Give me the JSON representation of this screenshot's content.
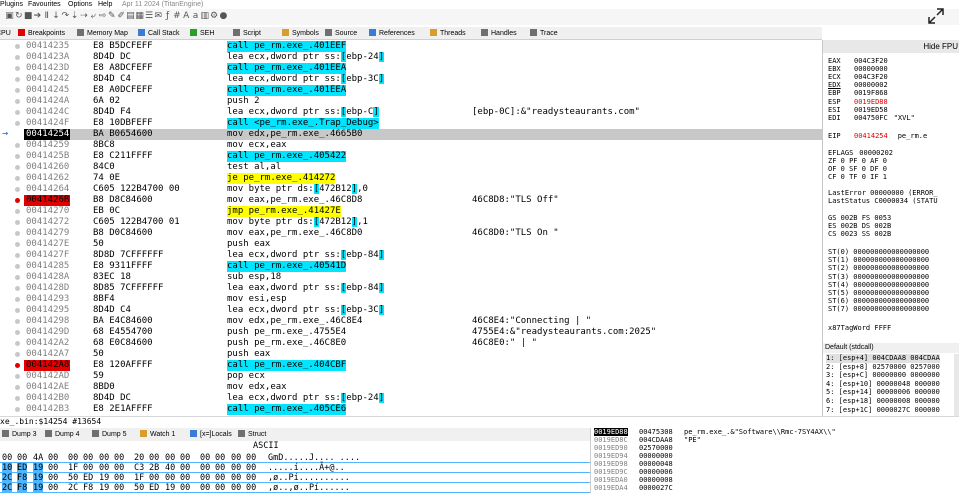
{
  "menu": {
    "items": [
      "Plugins",
      "Favourites",
      "Options",
      "Help"
    ],
    "version": "Apr 11 2024 (TitanEngine)"
  },
  "toolbar_icons": [
    "open-icon",
    "restart-icon",
    "close-icon",
    "run-icon",
    "pause-icon",
    "step-into-icon",
    "step-over-icon",
    "trace-into-icon",
    "trace-over-icon",
    "execute-till-return-icon",
    "run-to-user-code-icon",
    "highlight-icon",
    "pen-icon",
    "paint-icon",
    "calc-icon",
    "list-icon",
    "script-icon",
    "fx-icon",
    "hash-icon",
    "font-icon",
    "abc-icon",
    "patch-icon",
    "settings-icon",
    "help-icon"
  ],
  "tabs": [
    {
      "label": "CPU",
      "icon": "cpu-icon",
      "color": "#3a7bd5"
    },
    {
      "label": "Breakpoints",
      "icon": "breakpoint-icon",
      "color": "#e00000"
    },
    {
      "label": "Memory Map",
      "icon": "memory-map-icon",
      "color": "#707070"
    },
    {
      "label": "Call Stack",
      "icon": "call-stack-icon",
      "color": "#3a7bd5"
    },
    {
      "label": "SEH",
      "icon": "seh-icon",
      "color": "#2a9d2a"
    },
    {
      "label": "Script",
      "icon": "script-icon",
      "color": "#707070"
    },
    {
      "label": "Symbols",
      "icon": "symbols-icon",
      "color": "#d69e2e"
    },
    {
      "label": "Source",
      "icon": "source-icon",
      "color": "#707070"
    },
    {
      "label": "References",
      "icon": "references-icon",
      "color": "#3a7bd5"
    },
    {
      "label": "Threads",
      "icon": "threads-icon",
      "color": "#d69e2e"
    },
    {
      "label": "Handles",
      "icon": "handles-icon",
      "color": "#707070"
    },
    {
      "label": "Trace",
      "icon": "trace-icon",
      "color": "#707070"
    }
  ],
  "disasm": [
    {
      "addr": "00414235",
      "bytes": "E8 B5DCFEFF",
      "ins": "call pe_rm.exe_.401EEF",
      "hl": "call",
      "com": ""
    },
    {
      "addr": "0041423A",
      "bytes": "8D4D DC",
      "ins": "lea ecx,dword ptr ss:[ebp-24]",
      "hl": "seg",
      "com": ""
    },
    {
      "addr": "0041423D",
      "bytes": "E8 A8DCFEFF",
      "ins": "call pe_rm.exe_.401EEA",
      "hl": "call",
      "com": ""
    },
    {
      "addr": "00414242",
      "bytes": "8D4D C4",
      "ins": "lea ecx,dword ptr ss:[ebp-3C]",
      "hl": "seg",
      "com": ""
    },
    {
      "addr": "00414245",
      "bytes": "E8 A0DCFEFF",
      "ins": "call pe_rm.exe_.401EEA",
      "hl": "call",
      "com": ""
    },
    {
      "addr": "0041424A",
      "bytes": "6A 02",
      "ins": "push 2",
      "hl": "",
      "com": ""
    },
    {
      "addr": "0041424C",
      "bytes": "8D4D F4",
      "ins": "lea ecx,dword ptr ss:[ebp-C]",
      "hl": "seg",
      "com": "[ebp-0C]:&\"readysteaurants.com\""
    },
    {
      "addr": "0041424F",
      "bytes": "E8 10DBFEFF",
      "ins": "call <pe_rm.exe_.Trap_Debug>",
      "hl": "call",
      "com": ""
    },
    {
      "addr": "00414254",
      "bytes": "BA B0654600",
      "ins": "mov edx,pe_rm.exe_.4665B0",
      "hl": "",
      "com": "",
      "sel": true
    },
    {
      "addr": "00414259",
      "bytes": "8BC8",
      "ins": "mov ecx,eax",
      "hl": "",
      "com": ""
    },
    {
      "addr": "0041425B",
      "bytes": "E8 C211FFFF",
      "ins": "call pe_rm.exe_.405422",
      "hl": "call",
      "com": ""
    },
    {
      "addr": "00414260",
      "bytes": "84C0",
      "ins": "test al,al",
      "hl": "",
      "com": ""
    },
    {
      "addr": "00414262",
      "bytes": "74 0E",
      "ins": "je pe_rm.exe_.414272",
      "hl": "jmp",
      "com": ""
    },
    {
      "addr": "00414264",
      "bytes": "C605 122B4700 00",
      "ins": "mov byte ptr ds:[472B12],0",
      "hl": "seg",
      "com": ""
    },
    {
      "addr": "0041426B",
      "bytes": "B8 D8C84600",
      "ins": "mov eax,pe_rm.exe_.46C8D8",
      "hl": "",
      "com": "46C8D8:\"TLS Off\"",
      "bp": true
    },
    {
      "addr": "00414270",
      "bytes": "EB 0C",
      "ins": "jmp pe_rm.exe_.41427E",
      "hl": "jmp",
      "com": ""
    },
    {
      "addr": "00414272",
      "bytes": "C605 122B4700 01",
      "ins": "mov byte ptr ds:[472B12],1",
      "hl": "seg",
      "com": ""
    },
    {
      "addr": "00414279",
      "bytes": "B8 D0C84600",
      "ins": "mov eax,pe_rm.exe_.46C8D0",
      "hl": "",
      "com": "46C8D0:\"TLS On \""
    },
    {
      "addr": "0041427E",
      "bytes": "50",
      "ins": "push eax",
      "hl": "",
      "com": ""
    },
    {
      "addr": "0041427F",
      "bytes": "8D8D 7CFFFFFF",
      "ins": "lea ecx,dword ptr ss:[ebp-84]",
      "hl": "seg",
      "com": ""
    },
    {
      "addr": "00414285",
      "bytes": "E8 9311FFFF",
      "ins": "call pe_rm.exe_.40541D",
      "hl": "call",
      "com": ""
    },
    {
      "addr": "0041428A",
      "bytes": "83EC 18",
      "ins": "sub esp,18",
      "hl": "",
      "com": ""
    },
    {
      "addr": "0041428D",
      "bytes": "8D85 7CFFFFFF",
      "ins": "lea eax,dword ptr ss:[ebp-84]",
      "hl": "seg",
      "com": ""
    },
    {
      "addr": "00414293",
      "bytes": "8BF4",
      "ins": "mov esi,esp",
      "hl": "",
      "com": ""
    },
    {
      "addr": "00414295",
      "bytes": "8D4D C4",
      "ins": "lea ecx,dword ptr ss:[ebp-3C]",
      "hl": "seg",
      "com": ""
    },
    {
      "addr": "00414298",
      "bytes": "BA E4C84600",
      "ins": "mov edx,pe_rm.exe_.46C8E4",
      "hl": "",
      "com": "46C8E4:\"Connecting  | \""
    },
    {
      "addr": "0041429D",
      "bytes": "68 E4554700",
      "ins": "push pe_rm.exe_.4755E4",
      "hl": "",
      "com": "4755E4:&\"readysteaurants.com:2025\""
    },
    {
      "addr": "004142A2",
      "bytes": "68 E0C84600",
      "ins": "push pe_rm.exe_.46C8E0",
      "hl": "",
      "com": "46C8E0:\" | \""
    },
    {
      "addr": "004142A7",
      "bytes": "50",
      "ins": "push eax",
      "hl": "",
      "com": ""
    },
    {
      "addr": "004142A8",
      "bytes": "E8 120AFFFF",
      "ins": "call pe_rm.exe_.404CBF",
      "hl": "call",
      "com": "",
      "bp": true
    },
    {
      "addr": "004142AD",
      "bytes": "59",
      "ins": "pop ecx",
      "hl": "",
      "com": ""
    },
    {
      "addr": "004142AE",
      "bytes": "8BD0",
      "ins": "mov edx,eax",
      "hl": "",
      "com": ""
    },
    {
      "addr": "004142B0",
      "bytes": "8D4D DC",
      "ins": "lea ecx,dword ptr ss:[ebp-24]",
      "hl": "seg",
      "com": ""
    },
    {
      "addr": "004142B3",
      "bytes": "E8 2E1AFFFF",
      "ins": "call pe_rm.exe_.405CE6",
      "hl": "call",
      "com": ""
    }
  ],
  "rip_arrow": "→",
  "registers": {
    "hide_fpu": "Hide FPU",
    "general": [
      {
        "n": "EAX",
        "v": "004C3F20",
        "c": ""
      },
      {
        "n": "EBX",
        "v": "00000000",
        "c": ""
      },
      {
        "n": "ECX",
        "v": "004C3F20",
        "c": ""
      },
      {
        "n": "EDX",
        "v": "00000002",
        "c": "",
        "u": true
      },
      {
        "n": "EBP",
        "v": "0019F868",
        "c": ""
      },
      {
        "n": "ESP",
        "v": "0019ED88",
        "c": "",
        "red": true
      },
      {
        "n": "ESI",
        "v": "0019ED58",
        "c": ""
      },
      {
        "n": "EDI",
        "v": "004750FC",
        "c": "\"XVL\""
      }
    ],
    "eip": {
      "n": "EIP",
      "v": "00414254",
      "c": "pe_rm.e"
    },
    "eflags": {
      "n": "EFLAGS",
      "v": "00000202"
    },
    "flags": [
      "ZF 0  PF 0  AF 0",
      "OF 0  SF 0  DF 0",
      "CF 0  TF 0  IF 1"
    ],
    "lasterror": "LastError  00000000 (ERROR_",
    "laststatus": "LastStatus C0000034 (STATU",
    "segs": [
      "GS 002B  FS 0053",
      "ES 002B  DS 002B",
      "CS 0023  SS 002B"
    ],
    "st": [
      "ST(0) 000000000000000000",
      "ST(1) 000000000000000000",
      "ST(2) 000000000000000000",
      "ST(3) 000000000000000000",
      "ST(4) 000000000000000000",
      "ST(5) 000000000000000000",
      "ST(6) 000000000000000000",
      "ST(7) 000000000000000000"
    ],
    "x87": "x87TagWord FFFF"
  },
  "callconv": {
    "label": "Default (stdcall)",
    "rows": [
      "1: [esp+4] 004CDAA8 004CDAA",
      "2: [esp+8] 02570000 0257000",
      "3: [esp+C] 00000000 0000000",
      "4: [esp+10] 00000048 000000",
      "5: [esp+14] 00000006 000000",
      "6: [esp+18] 00000008 000000",
      "7: [esp+1C] 0000027C 000000"
    ]
  },
  "status_text": "xe_.bin:$14254 #13654",
  "dump": {
    "tabs": [
      "Dump 3",
      "Dump 4",
      "Dump 5",
      "Watch 1",
      "[x=]Locals",
      "Struct"
    ],
    "ascii_header": "ASCII",
    "rows": [
      {
        "h": [
          "00",
          "00",
          "4A",
          "00",
          "00",
          "00",
          "00",
          "00",
          "20",
          "00",
          "00",
          "00",
          "00",
          "00",
          "00",
          "00"
        ],
        "a": "GmD.....J.... ...."
      },
      {
        "h": [
          "10",
          "ED",
          "19",
          "00",
          "1F",
          "00",
          "00",
          "00",
          "C3",
          "2B",
          "40",
          "00",
          "00",
          "00",
          "00",
          "00"
        ],
        "a": ".....í....Ã+@.."
      },
      {
        "h": [
          "2C",
          "F8",
          "19",
          "00",
          "50",
          "ED",
          "19",
          "00",
          "1F",
          "00",
          "00",
          "00",
          "00",
          "00",
          "00",
          "00"
        ],
        "a": ",ø..Pí.........."
      },
      {
        "h": [
          "2C",
          "F8",
          "19",
          "00",
          "2C",
          "F8",
          "19",
          "00",
          "50",
          "ED",
          "19",
          "00",
          "00",
          "00",
          "00",
          "00"
        ],
        "a": ",ø..,ø..Pí......"
      }
    ]
  },
  "stack": [
    {
      "a": "0019ED88",
      "v": "00475308",
      "c": "pe_rm.exe_.&\"Software\\\\Rmc-7SY4AX\\\\\"",
      "sel": true
    },
    {
      "a": "0019ED8C",
      "v": "004CDAA8",
      "c": "\"PE\""
    },
    {
      "a": "0019ED90",
      "v": "02570000",
      "c": ""
    },
    {
      "a": "0019ED94",
      "v": "00000000",
      "c": ""
    },
    {
      "a": "0019ED98",
      "v": "00000048",
      "c": ""
    },
    {
      "a": "0019ED9C",
      "v": "00000006",
      "c": ""
    },
    {
      "a": "0019EDA0",
      "v": "00000008",
      "c": ""
    },
    {
      "a": "0019EDA4",
      "v": "0000027C",
      "c": ""
    }
  ]
}
